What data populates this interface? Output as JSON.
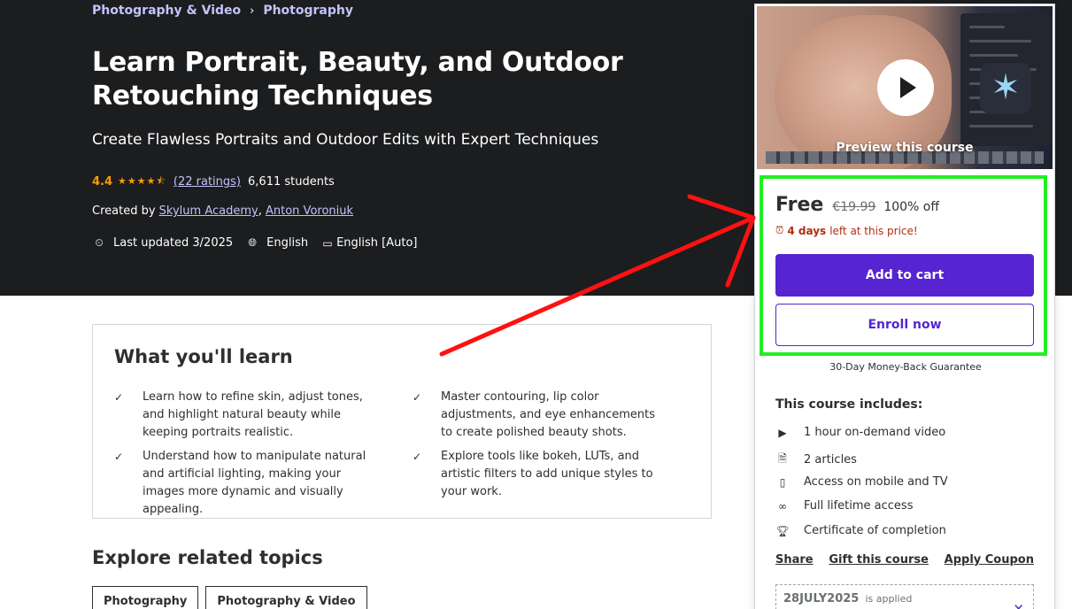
{
  "breadcrumb": [
    "Photography & Video",
    "Photography"
  ],
  "breadcrumb_sep": "›",
  "course": {
    "title": "Learn Portrait, Beauty, and Outdoor Retouching Techniques",
    "subtitle": "Create Flawless Portraits and Outdoor Edits with Expert Techniques",
    "rating": "4.4",
    "stars": "★★★★⯪",
    "star_fraction": 0.88,
    "ratings_link": "(22 ratings)",
    "students": "6,611 students",
    "created_by_label": "Created by",
    "authors": [
      "Skylum Academy",
      "Anton Voroniuk"
    ],
    "authors_sep": ",",
    "last_updated": "Last updated 3/2025",
    "language": "English",
    "captions": "English [Auto]"
  },
  "learn": {
    "title": "What you'll learn",
    "items": [
      "Learn how to refine skin, adjust tones, and highlight natural beauty while keeping portraits realistic.",
      "Master contouring, lip color adjustments, and eye enhancements to create polished beauty shots.",
      "Understand how to manipulate natural and artificial lighting, making your images more dynamic and visually appealing.",
      "Explore tools like bokeh, LUTs, and artistic filters to add unique styles to your work."
    ]
  },
  "explore": {
    "title": "Explore related topics",
    "topics": [
      "Photography",
      "Photography & Video"
    ]
  },
  "sidebar": {
    "preview_label": "Preview this course",
    "price": "Free",
    "original_price": "€19.99",
    "discount": "100% off",
    "timer_bold": "4 days",
    "timer_rest": "left at this price!",
    "add_to_cart": "Add to cart",
    "enroll_now": "Enroll now",
    "guarantee": "30-Day Money-Back Guarantee",
    "includes_title": "This course includes:",
    "includes": [
      {
        "icon": "video-icon",
        "label": "1 hour on-demand video"
      },
      {
        "icon": "article-icon",
        "label": "2 articles"
      },
      {
        "icon": "mobile-icon",
        "label": "Access on mobile and TV"
      },
      {
        "icon": "infinity-icon",
        "label": "Full lifetime access"
      },
      {
        "icon": "trophy-icon",
        "label": "Certificate of completion"
      }
    ],
    "links": [
      "Share",
      "Gift this course",
      "Apply Coupon"
    ],
    "coupon_code": "28JULY2025",
    "coupon_status": "is applied"
  },
  "colors": {
    "hero_bg": "#1c1d1f",
    "accent": "#5624d0",
    "star": "#f69c08",
    "link_light": "#c0c4fc",
    "timer": "#b32d0f",
    "highlight": "#22ee22",
    "arrow": "#ff1111"
  }
}
